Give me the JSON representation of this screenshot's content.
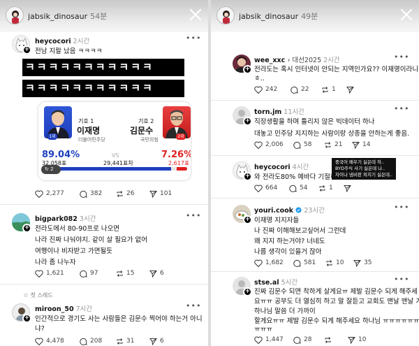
{
  "left_story": {
    "username": "jabsik_dinosaur",
    "time": "54분",
    "posts": [
      {
        "username": "heycocori",
        "time": "2시간",
        "lines": [
          "전남 지랄 났음 ㅋㅋㅋㅋ"
        ],
        "kk_lines": [
          "ㅋㅋㅋㅋㅋㅋㅋㅋㅋㅋㅋ",
          "ㅋㅋㅋㅋㅋㅋㅋㅋㅋㅋㅋ"
        ],
        "likes": "2,277",
        "comments": "382",
        "reposts": "26",
        "shares": "101"
      },
      {
        "username": "bigpark082",
        "time": "3시간",
        "lines": [
          "전라도에서 80-90프로 나오면",
          "나라 진짜 나눠야지. 같이 살 필요가 없어",
          "여행이나 비자받고 가면될듯",
          "나라 좀 나누자"
        ],
        "likes": "1,621",
        "comments": "97",
        "reposts": "15",
        "shares": "6"
      },
      {
        "username": "miroon_50",
        "time": "7시간",
        "lines": [
          "인간적으로 경기도 사는 사람들은 김문수 찍어야 하는거 아니",
          "냐?"
        ],
        "likes": "4,478",
        "comments": "208",
        "reposts": "31",
        "shares": "6"
      }
    ],
    "thread_label": "첫 스레드",
    "election": {
      "c1_number": "기호 1",
      "c1_name": "이재명",
      "c1_party": "더불어민주당",
      "c1_rank": "1위",
      "c1_pct": "89.04%",
      "c1_votes": "32,058표",
      "c2_number": "기호 2",
      "c2_name": "김문수",
      "c2_party": "국민의힘",
      "c2_rank": "2위",
      "c2_pct": "7.26%",
      "c2_votes": "2,617표",
      "vs": "VS",
      "gap": "29,441표차",
      "chip_count": "2",
      "c1_fraction": 0.8904,
      "c2_fraction": 0.0726
    }
  },
  "right_story": {
    "username": "jabsik_dinosaur",
    "time": "49분",
    "posts": [
      {
        "username": "wee_xxc",
        "tag": "대선2025",
        "time": "2시간",
        "lines": [
          "전라도는 혹시 인터넷이 안되는 지역인가요?? 이재명이라니",
          "ㅎ.."
        ],
        "likes": "242",
        "comments": "22",
        "reposts": "1",
        "shares": ""
      },
      {
        "username": "torn.jm",
        "time": "11시간",
        "lines": [
          "직장생활을 하며 틀리지 않은 빅데이터 하나",
          "대놓고 민주당 지지하는 사람이랑 상종을 안하는게 좋음."
        ],
        "likes": "2,006",
        "comments": "58",
        "reposts": "21",
        "shares": "14"
      },
      {
        "username": "heycocori",
        "time": "4시간",
        "lines": [
          "와 전라도80% 예바다 기절하겠노"
        ],
        "likes": "664",
        "comments": "54",
        "reposts": "1",
        "shares": ""
      },
      {
        "username": "youri.cook",
        "time": "23시간",
        "lines": [
          "이재명 지지자들",
          "나 진짜 이해해보고싶어서 그런데",
          "왜 지지 하는거야? 너네도",
          "나름 생각이 있을거 잖아"
        ],
        "likes": "1,682",
        "comments": "581",
        "reposts": "10",
        "shares": "35"
      },
      {
        "username": "stse.al",
        "time": "5시간",
        "lines": [
          "진짜 김문수 되면 착하게 살게요ㅠ 제발 김문수 되게 해주세",
          "요ㅠㅠ 공부도 더 열심히 하고 말 잘듣고 교회도 맨날 맨날 가고",
          "하나님 말씀 더 가까이",
          "할게요ㅠㅠ 제발 김문수 되게 해주세요 하나님 ㅠㅠㅠㅠㅠㅠㅠ",
          "ㅠㅠㅠ"
        ],
        "likes": "1,447",
        "comments": "28",
        "reposts": "",
        "shares": "10"
      }
    ],
    "caption_lines": [
      "중국어 배우기 싫은데 하..",
      "BYD주식 사기 싫은데 나..",
      "차이나 냄비판 외치기 싫은데.."
    ]
  },
  "colors": {
    "party1_blue": "#1f3fbf",
    "party2_red": "#e02020",
    "verified_blue": "#1d9bf0"
  }
}
